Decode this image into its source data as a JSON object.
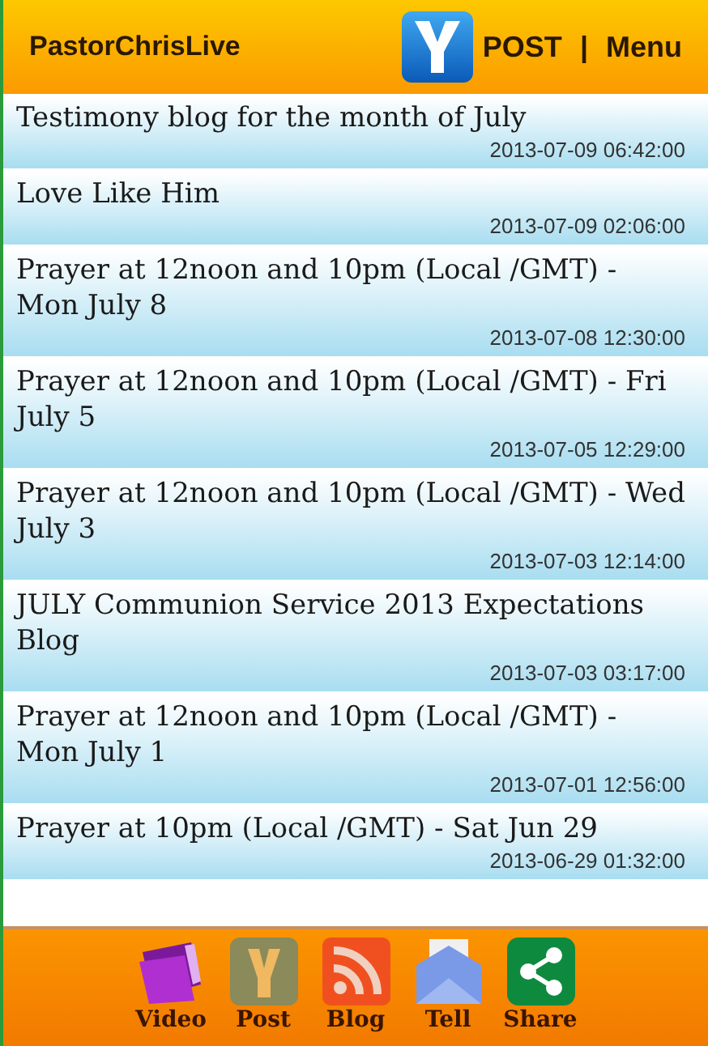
{
  "header": {
    "title": "PastorChrisLive",
    "post": "POST",
    "separator": "|",
    "menu": "Menu"
  },
  "posts": [
    {
      "title": "Testimony blog for the month of July",
      "date": "2013-07-09 06:42:00"
    },
    {
      "title": "Love Like Him",
      "date": "2013-07-09 02:06:00"
    },
    {
      "title": "Prayer at 12noon and 10pm (Local /GMT) - Mon July 8",
      "date": "2013-07-08 12:30:00"
    },
    {
      "title": "Prayer at 12noon and 10pm (Local /GMT) - Fri July 5",
      "date": "2013-07-05 12:29:00"
    },
    {
      "title": "Prayer at 12noon and 10pm (Local /GMT) - Wed July 3",
      "date": "2013-07-03 12:14:00"
    },
    {
      "title": "JULY Communion Service 2013 Expectations Blog",
      "date": "2013-07-03 03:17:00"
    },
    {
      "title": "Prayer at 12noon and 10pm (Local /GMT) - Mon July 1",
      "date": "2013-07-01 12:56:00"
    },
    {
      "title": "Prayer at 10pm (Local /GMT) - Sat Jun 29",
      "date": "2013-06-29 01:32:00"
    }
  ],
  "tabs": [
    {
      "kind": "video",
      "label": "Video"
    },
    {
      "kind": "post",
      "label": "Post"
    },
    {
      "kind": "blog",
      "label": "Blog"
    },
    {
      "kind": "tell",
      "label": "Tell"
    },
    {
      "kind": "share",
      "label": "Share"
    }
  ]
}
